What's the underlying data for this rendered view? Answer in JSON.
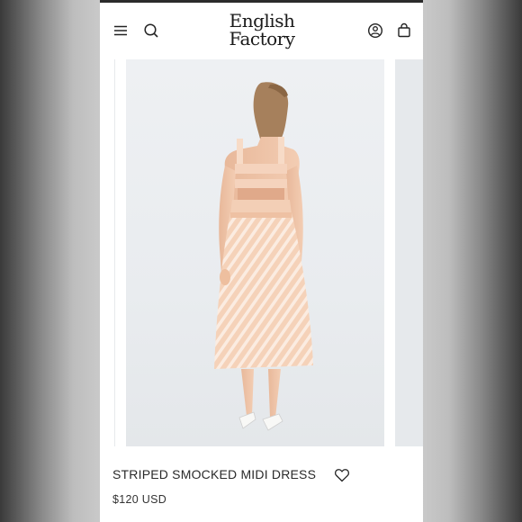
{
  "brand": {
    "line1": "English",
    "line2": "Factory"
  },
  "header": {
    "menu_icon": "hamburger-menu-icon",
    "search_icon": "search-icon",
    "account_icon": "account-icon",
    "cart_icon": "shopping-bag-icon"
  },
  "gallery": {
    "image_subject": "Model wearing peach striped midi dress, back view"
  },
  "product": {
    "title": "STRIPED SMOCKED MIDI DRESS",
    "price": "$120 USD",
    "wishlist_icon": "heart-icon"
  },
  "colors": {
    "dress": "#f6d6c0",
    "stripe": "#fbeee4",
    "background": "#e9ecef"
  }
}
